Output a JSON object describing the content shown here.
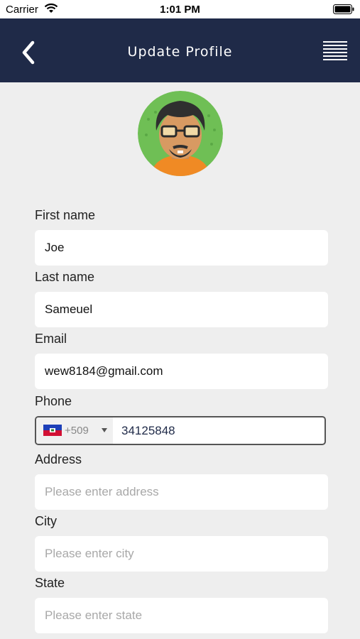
{
  "status_bar": {
    "carrier": "Carrier",
    "time": "1:01 PM"
  },
  "header": {
    "title": "Update Profile",
    "background_color": "#1f2a48"
  },
  "avatar": {
    "icon": "user-avatar-cartoon"
  },
  "form": {
    "first_name": {
      "label": "First name",
      "value": "Joe"
    },
    "last_name": {
      "label": "Last name",
      "value": "Sameuel"
    },
    "email": {
      "label": "Email",
      "value": "wew8184@gmail.com"
    },
    "phone": {
      "label": "Phone",
      "dial_code": "+509",
      "value": "34125848",
      "flag": "haiti-flag"
    },
    "address": {
      "label": "Address",
      "value": "",
      "placeholder": "Please enter address"
    },
    "city": {
      "label": "City",
      "value": "",
      "placeholder": "Please enter city"
    },
    "state": {
      "label": "State",
      "value": "",
      "placeholder": "Please enter state"
    }
  }
}
